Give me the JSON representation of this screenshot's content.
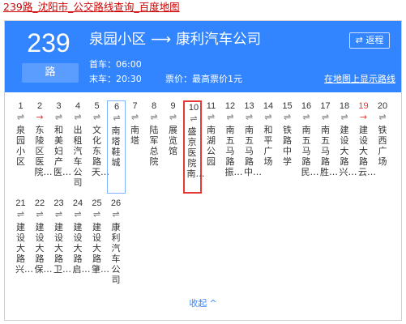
{
  "page_link": "239路_沈阳市_公交路线查询_百度地图",
  "route": {
    "number": "239",
    "unit": "路",
    "from": "泉园小区",
    "arrow": "⟶",
    "to": "康利汽车公司",
    "reverse_label": "⇄ 返程",
    "first_bus": "首车：06:00",
    "last_bus": "末车：20:30",
    "fare": "票价：最高票价1元",
    "map_link": "在地图上显示路线"
  },
  "stops_row1": [
    {
      "num": "1",
      "dir": "⇌",
      "name": "泉园小区"
    },
    {
      "num": "2",
      "dir": "→",
      "name": "东陵区医院…",
      "red": true
    },
    {
      "num": "3",
      "dir": "⇌",
      "name": "和美妇产医…"
    },
    {
      "num": "4",
      "dir": "⇌",
      "name": "出租汽车公司"
    },
    {
      "num": "5",
      "dir": "⇌",
      "name": "文化东路天…"
    },
    {
      "num": "6",
      "dir": "⇌",
      "name": "南塔鞋城",
      "sel": "blue"
    },
    {
      "num": "7",
      "dir": "⇌",
      "name": "南塔"
    },
    {
      "num": "8",
      "dir": "⇌",
      "name": "陆军总院"
    },
    {
      "num": "9",
      "dir": "⇌",
      "name": "展览馆"
    },
    {
      "num": "10",
      "dir": "⇌",
      "name": "盛京医院南…",
      "sel": "red"
    },
    {
      "num": "11",
      "dir": "⇌",
      "name": "南湖公园"
    },
    {
      "num": "12",
      "dir": "⇌",
      "name": "南五马路振…"
    },
    {
      "num": "13",
      "dir": "⇌",
      "name": "南五马路中…"
    },
    {
      "num": "14",
      "dir": "⇌",
      "name": "和平广场"
    },
    {
      "num": "15",
      "dir": "⇌",
      "name": "铁路中学"
    },
    {
      "num": "16",
      "dir": "⇌",
      "name": "南五马路民…"
    },
    {
      "num": "17",
      "dir": "⇌",
      "name": "南五马路胜…"
    },
    {
      "num": "18",
      "dir": "⇌",
      "name": "建设大路兴…"
    },
    {
      "num": "19",
      "dir": "→",
      "name": "建设大路云…",
      "red": true,
      "numred": true
    },
    {
      "num": "20",
      "dir": "⇌",
      "name": "铁西广场"
    }
  ],
  "stops_row2": [
    {
      "num": "21",
      "dir": "⇌",
      "name": "建设大路兴…"
    },
    {
      "num": "22",
      "dir": "⇌",
      "name": "建设大路保…"
    },
    {
      "num": "23",
      "dir": "⇌",
      "name": "建设大路卫…"
    },
    {
      "num": "24",
      "dir": "⇌",
      "name": "建设大路启…"
    },
    {
      "num": "25",
      "dir": "⇌",
      "name": "建设大路肇…"
    },
    {
      "num": "26",
      "dir": "⇌",
      "name": "康利汽车公司"
    }
  ],
  "collapse_label": "收起",
  "collapse_icon": "^"
}
